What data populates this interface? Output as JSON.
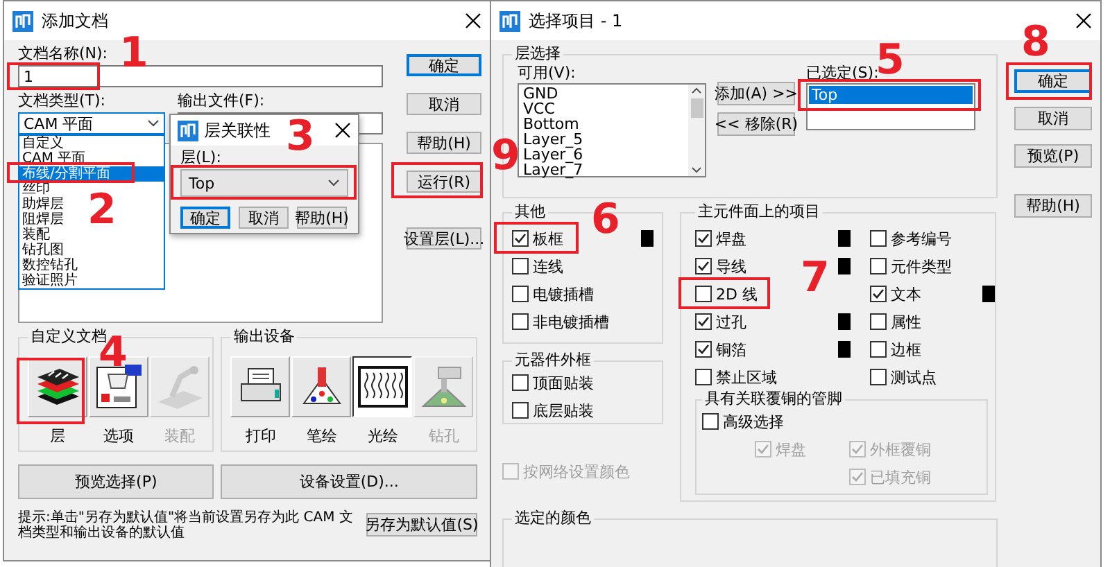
{
  "add_document_dialog": {
    "title": "添加文档",
    "name_label": "文档名称(N):",
    "name_value": "1",
    "type_label": "文档类型(T):",
    "type_value": "CAM 平面",
    "type_options": [
      {
        "label": "自定义",
        "selected": false
      },
      {
        "label": "CAM 平面",
        "selected": false
      },
      {
        "label": "布线/分割平面",
        "selected": true
      },
      {
        "label": "丝印",
        "selected": false
      },
      {
        "label": "助焊层",
        "selected": false
      },
      {
        "label": "阻焊层",
        "selected": false
      },
      {
        "label": "装配",
        "selected": false
      },
      {
        "label": "钻孔图",
        "selected": false
      },
      {
        "label": "数控钻孔",
        "selected": false
      },
      {
        "label": "验证照片",
        "selected": false
      }
    ],
    "output_label": "输出文件(F):",
    "buttons": [
      {
        "label": "确定",
        "default": true
      },
      {
        "label": "取消",
        "default": false
      },
      {
        "label": "帮助(H)",
        "default": false
      },
      {
        "label": "运行(R)",
        "default": false
      },
      {
        "label": "设置层(L)...",
        "default": false
      }
    ],
    "custom_group": {
      "title": "自定义文档",
      "items": [
        {
          "label": "层",
          "kind": "layers",
          "disabled": false
        },
        {
          "label": "选项",
          "kind": "options",
          "disabled": false
        },
        {
          "label": "装配",
          "kind": "assembly",
          "disabled": true
        }
      ]
    },
    "device_group": {
      "title": "输出设备",
      "items": [
        {
          "label": "打印",
          "kind": "printer",
          "selected": false,
          "disabled": false
        },
        {
          "label": "笔绘",
          "kind": "pen",
          "selected": false,
          "disabled": false
        },
        {
          "label": "光绘",
          "kind": "photo",
          "selected": true,
          "disabled": false
        },
        {
          "label": "钻孔",
          "kind": "drill",
          "selected": false,
          "disabled": true
        }
      ]
    },
    "preview_button": "预览选择(P)",
    "device_setup_button": "设备设置(D)...",
    "hint": "提示:单击\"另存为默认值\"将当前设置另存为此 CAM 文档类型和输出设备的默认值",
    "save_default_button": "另存为默认值(S)"
  },
  "layer_association_popup": {
    "title": "层关联性",
    "layer_label": "层(L):",
    "layer_value": "Top",
    "buttons": [
      {
        "label": "确定",
        "default": true
      },
      {
        "label": "取消",
        "default": false
      },
      {
        "label": "帮助(H)",
        "default": false
      }
    ]
  },
  "select_items_dialog": {
    "title": "选择项目 - 1",
    "layer_group": {
      "title": "层选择",
      "available_label": "可用(V):",
      "available": [
        "GND",
        "VCC",
        "Bottom",
        "Layer_5",
        "Layer_6",
        "Layer_7"
      ],
      "add_button": "添加(A) >>",
      "remove_button": "<< 移除(R)",
      "selected_label": "已选定(S):",
      "selected": [
        {
          "label": "Top",
          "selected": true
        }
      ]
    },
    "buttons": [
      {
        "label": "确定",
        "default": true
      },
      {
        "label": "取消",
        "default": false
      },
      {
        "label": "预览(P)",
        "default": false
      },
      {
        "label": "帮助(H)",
        "default": false
      }
    ],
    "other_group": {
      "title": "其他",
      "items": [
        {
          "label": "板框",
          "checked": true,
          "swatch": true
        },
        {
          "label": "连线",
          "checked": false,
          "swatch": false
        },
        {
          "label": "电镀插槽",
          "checked": false,
          "swatch": false
        },
        {
          "label": "非电镀插槽",
          "checked": false,
          "swatch": false
        }
      ]
    },
    "outline_group": {
      "title": "元器件外框",
      "items": [
        {
          "label": "顶面贴装",
          "checked": false
        },
        {
          "label": "底层贴装",
          "checked": false
        }
      ]
    },
    "net_color": {
      "label": "按网络设置颜色",
      "checked": false,
      "disabled": true
    },
    "primary_group": {
      "title": "主元件面上的项目",
      "columns": [
        [
          {
            "label": "焊盘",
            "checked": true,
            "swatch": true
          },
          {
            "label": "导线",
            "checked": true,
            "swatch": true
          },
          {
            "label": "2D 线",
            "checked": false,
            "swatch": false
          },
          {
            "label": "过孔",
            "checked": true,
            "swatch": true
          },
          {
            "label": "铜箔",
            "checked": true,
            "swatch": true
          },
          {
            "label": "禁止区域",
            "checked": false,
            "swatch": false
          }
        ],
        [
          {
            "label": "参考编号",
            "checked": false,
            "swatch": false
          },
          {
            "label": "元件类型",
            "checked": false,
            "swatch": false
          },
          {
            "label": "文本",
            "checked": true,
            "swatch": true
          },
          {
            "label": "属性",
            "checked": false,
            "swatch": false
          },
          {
            "label": "边框",
            "checked": false,
            "swatch": false
          },
          {
            "label": "测试点",
            "checked": false,
            "swatch": false
          }
        ]
      ]
    },
    "pins_group": {
      "title": "具有关联覆铜的管脚",
      "items": [
        {
          "label": "高级选择",
          "checked": false,
          "disabled": false
        },
        {
          "label": "焊盘",
          "checked": true,
          "disabled": true
        },
        {
          "label": "外框覆铜",
          "checked": true,
          "disabled": true
        },
        {
          "label": "已填充铜",
          "checked": true,
          "disabled": true
        }
      ]
    },
    "selected_color_group": {
      "title": "选定的颜色"
    }
  },
  "annotations": [
    {
      "label": "1"
    },
    {
      "label": "2"
    },
    {
      "label": "3"
    },
    {
      "label": "4"
    },
    {
      "label": "5"
    },
    {
      "label": "6"
    },
    {
      "label": "7"
    },
    {
      "label": "8"
    },
    {
      "label": "9"
    }
  ]
}
